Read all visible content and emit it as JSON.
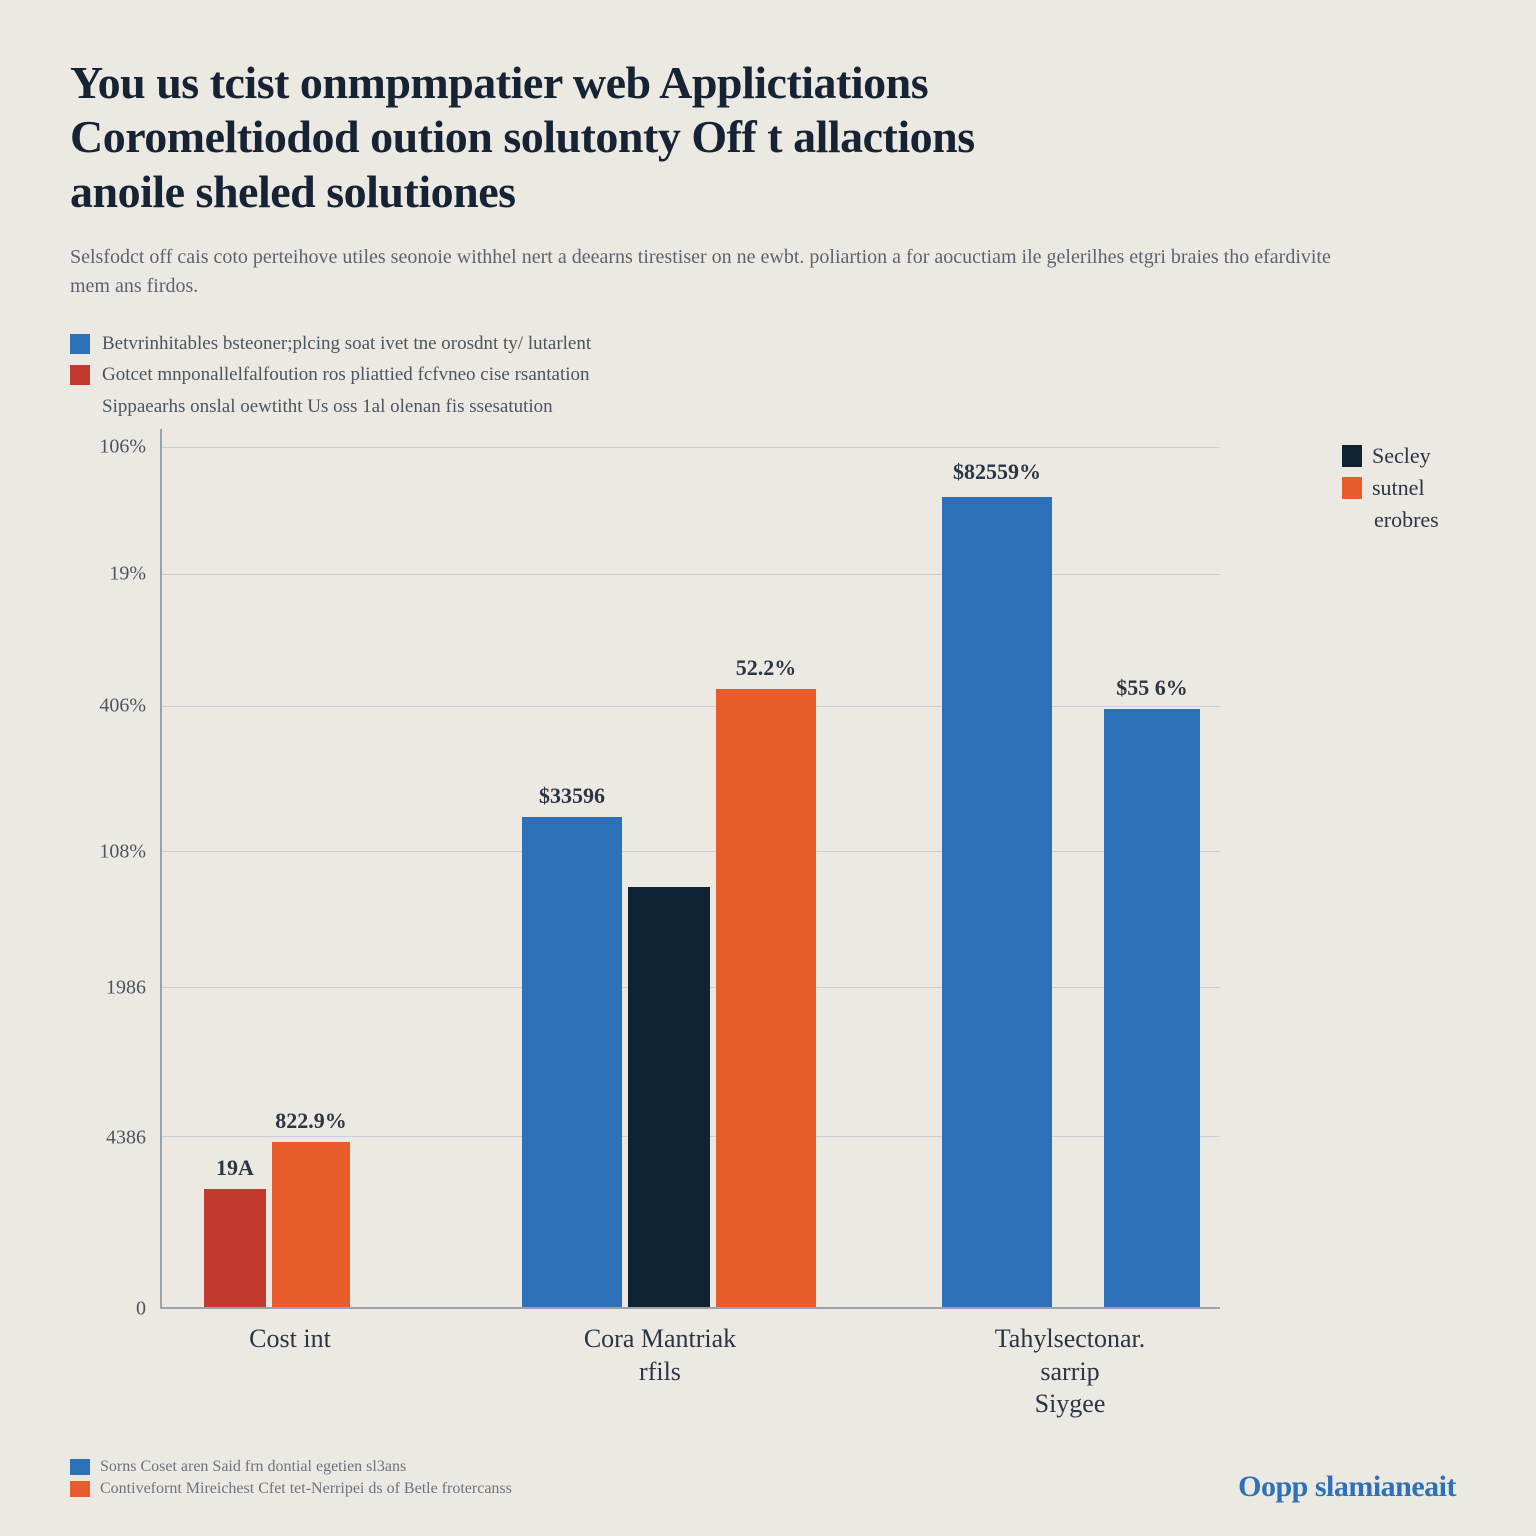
{
  "title_line1": "You us tcist onmpmpatier web Applictiations",
  "title_line2": "Coromeltiodod oution solutonty Off t allactions",
  "title_line3": "anoile sheled solutiones",
  "subtitle": "Selsfodct off cais coto perteihove utiles seonoie withhel nert a deearns tirestiser on ne ewbt. poliartion a for aocuctiam ile gelerilhes etgri braies tho efardivite mem ans firdos.",
  "legend_top": {
    "a": "Betvrinhitables bsteoner;plcing soat ivet tne orosdnt ty/ lutarlent",
    "b": "Gotcet mnponallelfalfoution ros pliattied fcfvneo cise rsantation",
    "c": "Sippaearhs onslal oewtitht Us oss 1al olenan fis ssesatution"
  },
  "side_legend": {
    "a": "Secley",
    "b": "sutnel",
    "c": "erobres"
  },
  "yaxis_ticks": [
    "106%",
    "19%",
    "406%",
    "108%",
    "1986",
    "4386",
    "0"
  ],
  "xaxis": {
    "c0": "Cost int",
    "c1": "Cora Mantriak\nrfils",
    "c2": "Tahylsectonar. sarrip\nSiygee"
  },
  "data_labels": {
    "g0b0": "19A",
    "g0b1": "822.9%",
    "g1b0": "$33596",
    "g1b2": "52.2%",
    "g2b0": "$82559%",
    "g2b1": "$55 6%"
  },
  "footer": {
    "a": "Sorns Coset aren Said frn dontial egetien sl3ans",
    "b": "Contivefornt Mireichest Cfet tet-Nerripei ds of Betle frotercanss"
  },
  "brand": "Oopp slamianeait",
  "chart_data": {
    "type": "bar",
    "title": "You us tcist onmpmpatier web Applictiations Coromeltiodod oution solutonty Off t allactions anoile sheled solutiones",
    "ylabel": "",
    "xlabel": "",
    "ylim": [
      0,
      120
    ],
    "y_tick_labels": [
      "106%",
      "19%",
      "406%",
      "108%",
      "1986",
      "4386",
      "0"
    ],
    "categories": [
      "Cost int",
      "Cora Mantriak rfils",
      "Tahylsectonar. sarrip Siygee"
    ],
    "series": [
      {
        "name": "Secley",
        "color": "#102335",
        "values": [
          null,
          56,
          null
        ]
      },
      {
        "name": "sutnel",
        "color": "#e85b2b",
        "values": [
          22,
          83,
          null
        ]
      },
      {
        "name": "erobres",
        "color": "#2d72b8",
        "values": [
          16,
          65,
          108
        ]
      },
      {
        "name": "extra-blue",
        "color": "#2d72b8",
        "values": [
          null,
          null,
          80
        ]
      },
      {
        "name": "extra-red",
        "color": "#c23a2e",
        "values": [
          15,
          null,
          null
        ]
      }
    ],
    "value_labels": {
      "Cost int": [
        "19A",
        "822.9%"
      ],
      "Cora Mantriak rfils": [
        "$33596",
        "52.2%"
      ],
      "Tahylsectonar. sarrip Siygee": [
        "$82559%",
        "$55 6%"
      ]
    }
  }
}
